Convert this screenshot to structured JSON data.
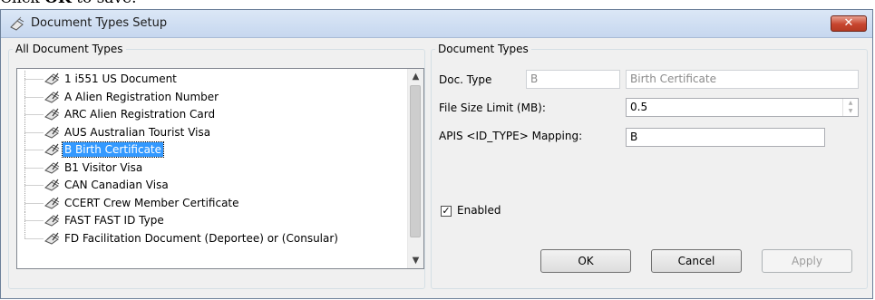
{
  "caption": {
    "prefix": "Click ",
    "bold": "OK",
    "suffix": " to save."
  },
  "window": {
    "title": "Document Types Setup",
    "close_label": "✕"
  },
  "all_types": {
    "legend": "All Document Types",
    "items": [
      {
        "label": "1  i551 US Document"
      },
      {
        "label": "A  Alien Registration Number"
      },
      {
        "label": "ARC  Alien Registration Card"
      },
      {
        "label": "AUS  Australian Tourist Visa"
      },
      {
        "label": "B  Birth Certificate",
        "selected": true
      },
      {
        "label": "B1  Visitor Visa"
      },
      {
        "label": "CAN  Canadian Visa"
      },
      {
        "label": "CCERT  Crew Member Certificate"
      },
      {
        "label": "FAST  FAST ID Type"
      },
      {
        "label": "FD  Facilitation Document (Deportee) or (Consular)"
      }
    ]
  },
  "doc_types": {
    "legend": "Document Types",
    "doc_type_label": "Doc. Type",
    "doc_type_code": "B",
    "doc_type_name": "Birth Certificate",
    "file_size_label": "File Size Limit (MB):",
    "file_size_value": "0.5",
    "apis_label": "APIS <ID_TYPE> Mapping:",
    "apis_value": "B",
    "enabled_label": "Enabled",
    "enabled_checked": "✓"
  },
  "buttons": {
    "ok": "OK",
    "cancel": "Cancel",
    "apply": "Apply"
  },
  "icons": {
    "title": "document-setup-icon",
    "tree": "document-pen-icon",
    "close": "close-icon"
  }
}
